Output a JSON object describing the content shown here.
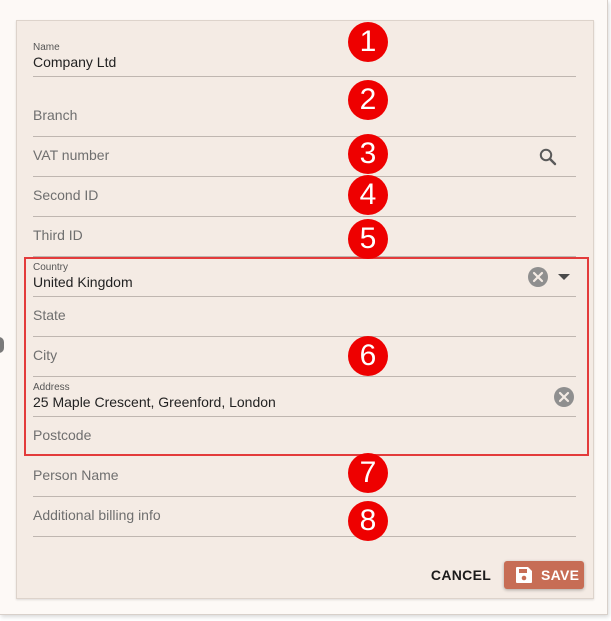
{
  "form": {
    "name": {
      "label": "Name",
      "value": "Company Ltd"
    },
    "branch": {
      "placeholder": "Branch"
    },
    "vat_number": {
      "placeholder": "VAT number"
    },
    "second_id": {
      "placeholder": "Second ID"
    },
    "third_id": {
      "placeholder": "Third ID"
    },
    "country": {
      "label": "Country",
      "value": "United Kingdom"
    },
    "state": {
      "placeholder": "State"
    },
    "city": {
      "placeholder": "City"
    },
    "address": {
      "label": "Address",
      "value": "25 Maple Crescent, Greenford, London"
    },
    "postcode": {
      "placeholder": "Postcode"
    },
    "person_name": {
      "placeholder": "Person Name"
    },
    "additional_billing_info": {
      "placeholder": "Additional billing info"
    }
  },
  "badges": [
    "1",
    "2",
    "3",
    "4",
    "5",
    "6",
    "7",
    "8"
  ],
  "actions": {
    "cancel_label": "CANCEL",
    "save_label": "SAVE"
  },
  "colors": {
    "badge": "#ee0000",
    "highlight_border": "#e33b3b",
    "save_button": "#c76d55",
    "card_background": "#f4ebe4"
  },
  "icons": {
    "vat_lookup": "search-icon",
    "country_clear": "clear-circle-icon",
    "country_dropdown": "caret-down-icon",
    "address_clear": "clear-circle-icon",
    "save": "floppy-disk-icon"
  }
}
